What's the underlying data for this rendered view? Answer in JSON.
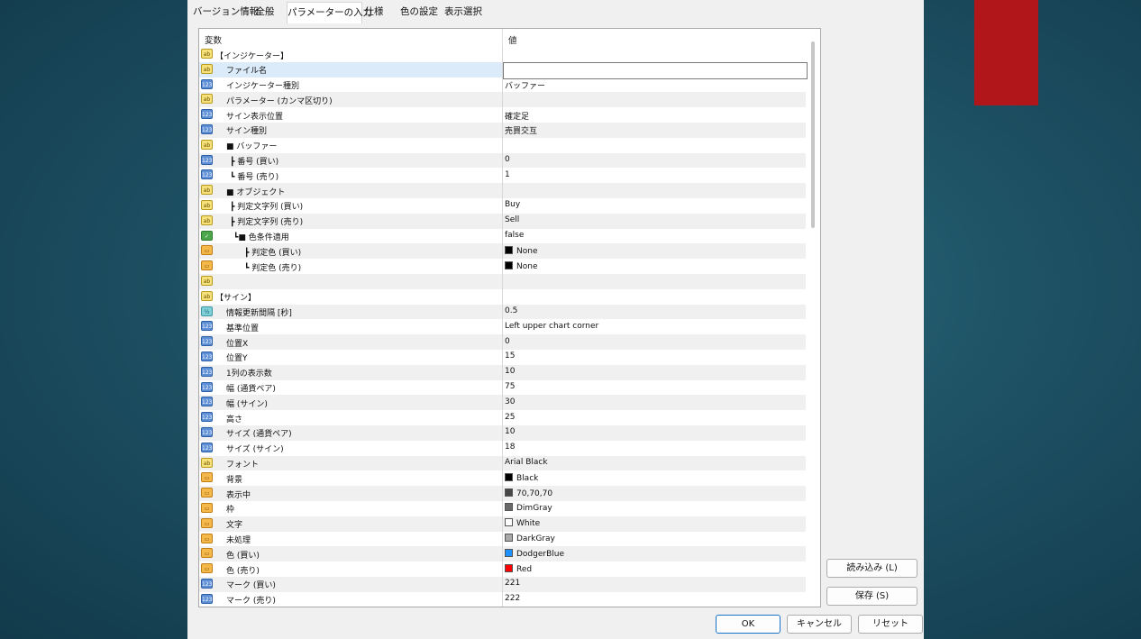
{
  "tabs": [
    {
      "label": "バージョン情報"
    },
    {
      "label": "全般"
    },
    {
      "label": "パラメーターの入力"
    },
    {
      "label": "仕様"
    },
    {
      "label": "色の設定"
    },
    {
      "label": "表示選択"
    }
  ],
  "active_tab": "パラメーターの入力",
  "grid": {
    "header": {
      "variable": "変数",
      "value": "値"
    },
    "rows": [
      {
        "icon": "ab",
        "name": "【インジケーター】",
        "value": ""
      },
      {
        "icon": "ab",
        "name": "ファイル名",
        "value": "",
        "selected": true
      },
      {
        "icon": "num",
        "name": "インジケーター種別",
        "value": "バッファー"
      },
      {
        "icon": "ab",
        "name": "パラメーター (カンマ区切り)",
        "value": ""
      },
      {
        "icon": "num",
        "name": "サイン表示位置",
        "value": "確定足"
      },
      {
        "icon": "num",
        "name": "サイン種別",
        "value": "売買交互"
      },
      {
        "icon": "ab",
        "name": "■ バッファー",
        "value": ""
      },
      {
        "icon": "num",
        "name": "┣ 番号 (買い)",
        "value": "0"
      },
      {
        "icon": "num",
        "name": "┗ 番号 (売り)",
        "value": "1"
      },
      {
        "icon": "ab",
        "name": "■ オブジェクト",
        "value": ""
      },
      {
        "icon": "ab",
        "name": "┣ 判定文字列 (買い)",
        "value": "Buy"
      },
      {
        "icon": "ab",
        "name": "┣ 判定文字列 (売り)",
        "value": "Sell"
      },
      {
        "icon": "bool",
        "name": "┗■ 色条件適用",
        "value": "false"
      },
      {
        "icon": "color",
        "name": "┣ 判定色 (買い)",
        "value": "None",
        "swatch": "#000000"
      },
      {
        "icon": "color",
        "name": "┗ 判定色 (売り)",
        "value": "None",
        "swatch": "#000000"
      },
      {
        "icon": "ab",
        "name": "",
        "value": ""
      },
      {
        "icon": "ab",
        "name": "【サイン】",
        "value": ""
      },
      {
        "icon": "dbl",
        "name": "情報更新間隔 [秒]",
        "value": "0.5"
      },
      {
        "icon": "num",
        "name": "基準位置",
        "value": "Left upper chart corner"
      },
      {
        "icon": "num",
        "name": "位置X",
        "value": "0"
      },
      {
        "icon": "num",
        "name": "位置Y",
        "value": "15"
      },
      {
        "icon": "num",
        "name": "1列の表示数",
        "value": "10"
      },
      {
        "icon": "num",
        "name": "幅 (通貨ペア)",
        "value": "75"
      },
      {
        "icon": "num",
        "name": "幅 (サイン)",
        "value": "30"
      },
      {
        "icon": "num",
        "name": "高さ",
        "value": "25"
      },
      {
        "icon": "num",
        "name": "サイズ (通貨ペア)",
        "value": "10"
      },
      {
        "icon": "num",
        "name": "サイズ (サイン)",
        "value": "18"
      },
      {
        "icon": "ab",
        "name": "フォント",
        "value": "Arial Black"
      },
      {
        "icon": "color",
        "name": "背景",
        "value": "Black",
        "swatch": "#000000"
      },
      {
        "icon": "color",
        "name": "表示中",
        "value": "70,70,70",
        "swatch": "#464646"
      },
      {
        "icon": "color",
        "name": "枠",
        "value": "DimGray",
        "swatch": "#696969"
      },
      {
        "icon": "color",
        "name": "文字",
        "value": "White",
        "swatch": "#ffffff"
      },
      {
        "icon": "color",
        "name": "未処理",
        "value": "DarkGray",
        "swatch": "#a9a9a9"
      },
      {
        "icon": "color",
        "name": "色 (買い)",
        "value": "DodgerBlue",
        "swatch": "#1e90ff"
      },
      {
        "icon": "color",
        "name": "色 (売り)",
        "value": "Red",
        "swatch": "#ff0000"
      },
      {
        "icon": "num",
        "name": "マーク (買い)",
        "value": "221"
      },
      {
        "icon": "num",
        "name": "マーク (売り)",
        "value": "222"
      }
    ]
  },
  "buttons": {
    "load": "読み込み (L)",
    "save": "保存 (S)",
    "ok": "OK",
    "cancel": "キャンセル",
    "reset": "リセット"
  },
  "colors": {
    "accent_red": "#b0161a",
    "ok_border": "#1a73c8"
  }
}
